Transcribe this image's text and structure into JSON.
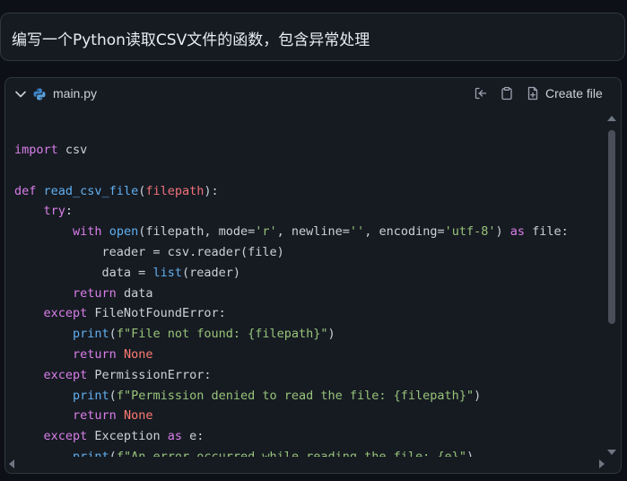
{
  "prompt": {
    "text": "编写一个Python读取CSV文件的函数，包含异常处理"
  },
  "code_block": {
    "filename": "main.py",
    "create_file_label": "Create file",
    "icons": {
      "collapse": "chevron-down-icon",
      "language": "python-icon",
      "insert": "insert-into-editor-icon",
      "copy": "clipboard-icon",
      "new_file": "new-file-icon"
    },
    "lines": [
      [
        {
          "t": "import",
          "c": "kw"
        },
        {
          "t": " csv",
          "c": "id"
        }
      ],
      [],
      [
        {
          "t": "def",
          "c": "kw"
        },
        {
          "t": " ",
          "c": "id"
        },
        {
          "t": "read_csv_file",
          "c": "fn"
        },
        {
          "t": "(",
          "c": "id"
        },
        {
          "t": "filepath",
          "c": "param"
        },
        {
          "t": "):",
          "c": "id"
        }
      ],
      [
        {
          "t": "    ",
          "c": "id"
        },
        {
          "t": "try",
          "c": "kw"
        },
        {
          "t": ":",
          "c": "id"
        }
      ],
      [
        {
          "t": "        ",
          "c": "id"
        },
        {
          "t": "with",
          "c": "kw"
        },
        {
          "t": " ",
          "c": "id"
        },
        {
          "t": "open",
          "c": "fn"
        },
        {
          "t": "(filepath, mode=",
          "c": "id"
        },
        {
          "t": "'r'",
          "c": "str"
        },
        {
          "t": ", newline=",
          "c": "id"
        },
        {
          "t": "''",
          "c": "str"
        },
        {
          "t": ", encoding=",
          "c": "id"
        },
        {
          "t": "'utf-8'",
          "c": "str"
        },
        {
          "t": ") ",
          "c": "id"
        },
        {
          "t": "as",
          "c": "kw"
        },
        {
          "t": " file:",
          "c": "id"
        }
      ],
      [
        {
          "t": "            reader = csv.reader(file)",
          "c": "id"
        }
      ],
      [
        {
          "t": "            data = ",
          "c": "id"
        },
        {
          "t": "list",
          "c": "fn"
        },
        {
          "t": "(reader)",
          "c": "id"
        }
      ],
      [
        {
          "t": "        ",
          "c": "id"
        },
        {
          "t": "return",
          "c": "kw"
        },
        {
          "t": " data",
          "c": "id"
        }
      ],
      [
        {
          "t": "    ",
          "c": "id"
        },
        {
          "t": "except",
          "c": "kw"
        },
        {
          "t": " FileNotFoundError:",
          "c": "id"
        }
      ],
      [
        {
          "t": "        ",
          "c": "id"
        },
        {
          "t": "print",
          "c": "fn"
        },
        {
          "t": "(",
          "c": "id"
        },
        {
          "t": "f\"File not found: {filepath}\"",
          "c": "str"
        },
        {
          "t": ")",
          "c": "id"
        }
      ],
      [
        {
          "t": "        ",
          "c": "id"
        },
        {
          "t": "return",
          "c": "kw"
        },
        {
          "t": " ",
          "c": "id"
        },
        {
          "t": "None",
          "c": "const"
        }
      ],
      [
        {
          "t": "    ",
          "c": "id"
        },
        {
          "t": "except",
          "c": "kw"
        },
        {
          "t": " PermissionError:",
          "c": "id"
        }
      ],
      [
        {
          "t": "        ",
          "c": "id"
        },
        {
          "t": "print",
          "c": "fn"
        },
        {
          "t": "(",
          "c": "id"
        },
        {
          "t": "f\"Permission denied to read the file: {filepath}\"",
          "c": "str"
        },
        {
          "t": ")",
          "c": "id"
        }
      ],
      [
        {
          "t": "        ",
          "c": "id"
        },
        {
          "t": "return",
          "c": "kw"
        },
        {
          "t": " ",
          "c": "id"
        },
        {
          "t": "None",
          "c": "const"
        }
      ],
      [
        {
          "t": "    ",
          "c": "id"
        },
        {
          "t": "except",
          "c": "kw"
        },
        {
          "t": " Exception ",
          "c": "id"
        },
        {
          "t": "as",
          "c": "kw"
        },
        {
          "t": " e:",
          "c": "id"
        }
      ],
      [
        {
          "t": "        ",
          "c": "id"
        },
        {
          "t": "print",
          "c": "fn"
        },
        {
          "t": "(",
          "c": "id"
        },
        {
          "t": "f\"An error occurred while reading the file: {e}\"",
          "c": "str"
        },
        {
          "t": ")",
          "c": "id"
        }
      ]
    ]
  },
  "colors": {
    "keyword": "#d97ee8",
    "function": "#61afef",
    "parameter": "#f07178",
    "string": "#98c379",
    "constant": "#ff7b72",
    "text": "#c9d1d9",
    "background": "#161b22",
    "page_background": "#0d1117"
  }
}
